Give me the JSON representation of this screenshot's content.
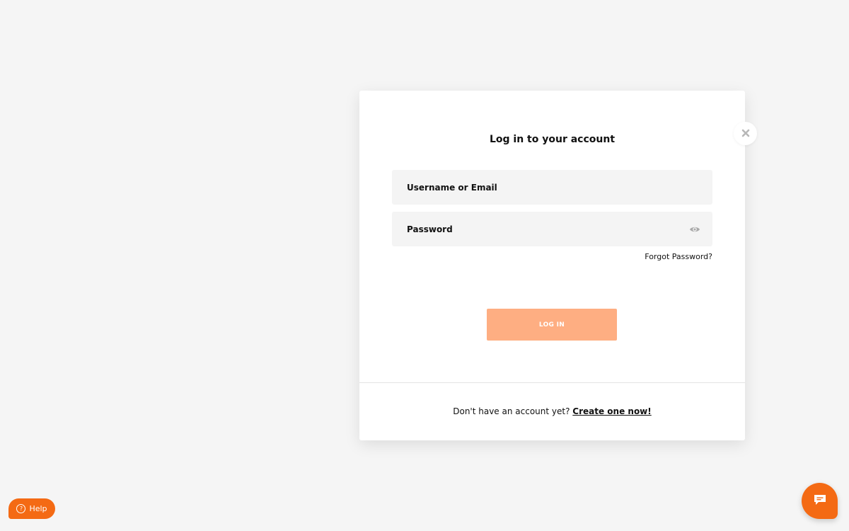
{
  "modal": {
    "title": "Log in to your account",
    "username_placeholder": "Username or Email",
    "password_placeholder": "Password",
    "forgot_password": "Forgot Password?",
    "login_button": "LOG IN",
    "no_account_text": "Don't have an account yet?",
    "create_account_link": "Create one now!"
  },
  "widgets": {
    "help_label": "Help",
    "help_icon_glyph": "?"
  },
  "icons": {
    "close": "close-icon",
    "password_visibility": "eye-icon",
    "help": "question-circle-icon",
    "chat": "chat-bubble-icon"
  },
  "colors": {
    "background": "#f5f5f5",
    "accent": "#f46a14",
    "login_button_disabled": "#feae82",
    "field_background": "#f4f4f4"
  }
}
